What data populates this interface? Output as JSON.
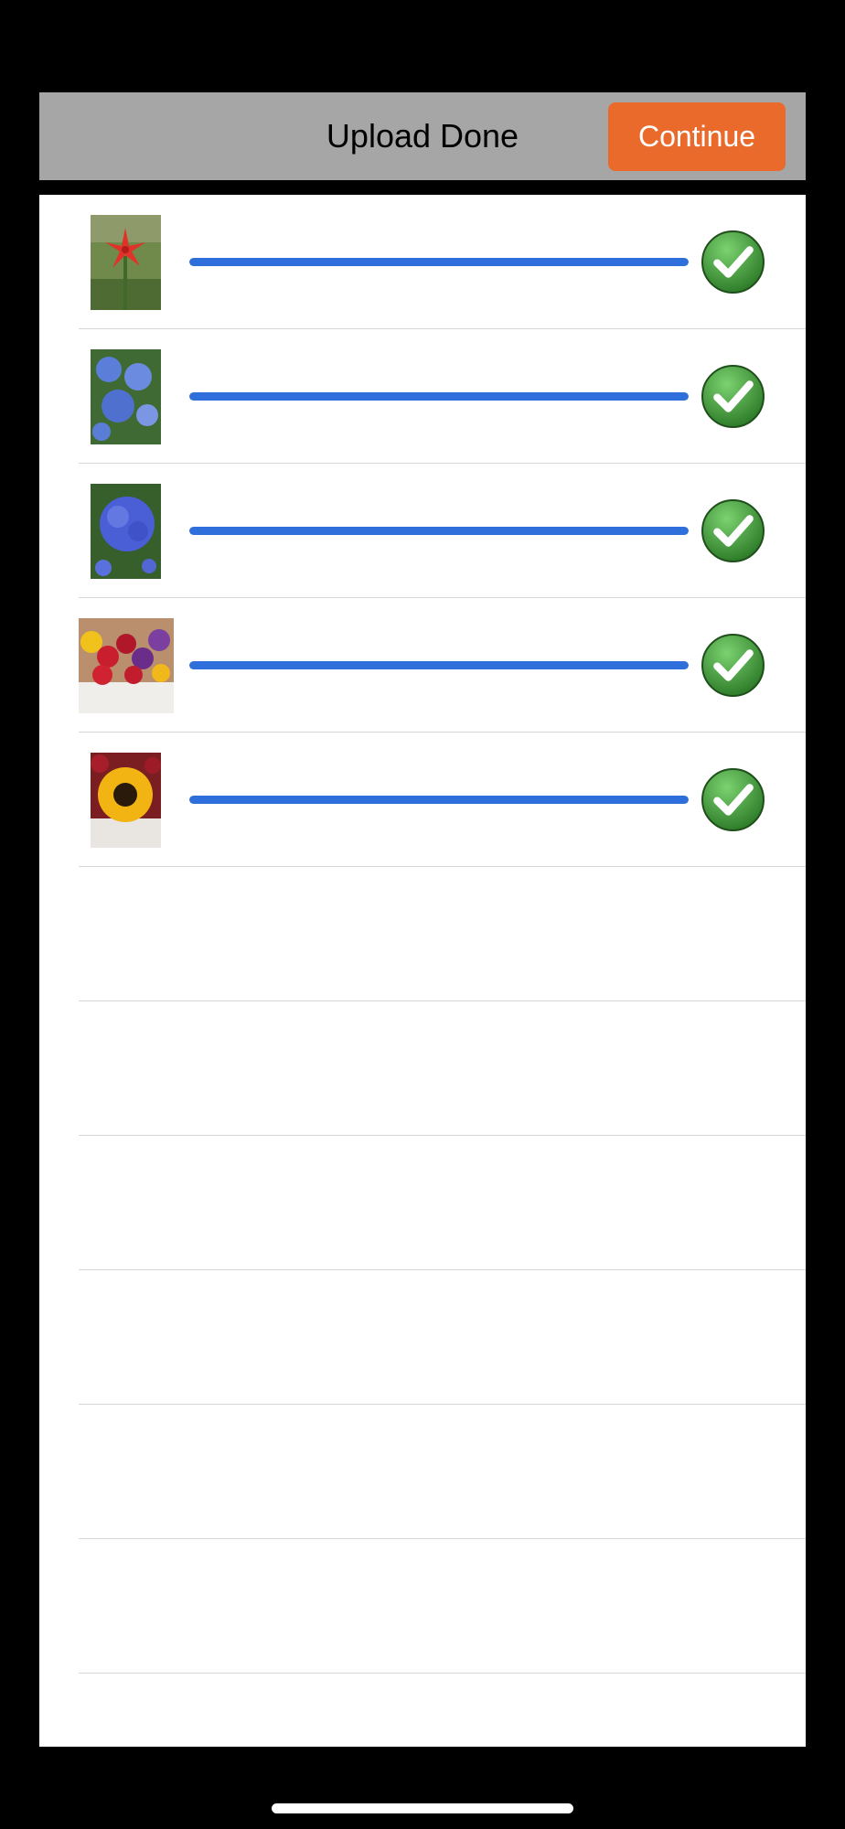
{
  "header": {
    "title": "Upload Done",
    "continue_label": "Continue",
    "continue_color": "#ea6a2b",
    "background_color": "#a6a6a6"
  },
  "uploads": [
    {
      "thumbnail": "red-lily-photo",
      "progress": 1.0,
      "status": "complete",
      "status_icon": "green-check-icon"
    },
    {
      "thumbnail": "blue-hydrangea-photo",
      "progress": 1.0,
      "status": "complete",
      "status_icon": "green-check-icon"
    },
    {
      "thumbnail": "purple-hydrangea-photo",
      "progress": 1.0,
      "status": "complete",
      "status_icon": "green-check-icon"
    },
    {
      "thumbnail": "rose-bouquet-photo",
      "progress": 1.0,
      "status": "complete",
      "status_icon": "green-check-icon"
    },
    {
      "thumbnail": "sunflower-photo",
      "progress": 1.0,
      "status": "complete",
      "status_icon": "green-check-icon"
    }
  ],
  "empty_rows": 6,
  "colors": {
    "progress": "#2f6fdc",
    "check": "#3f9b3a"
  }
}
